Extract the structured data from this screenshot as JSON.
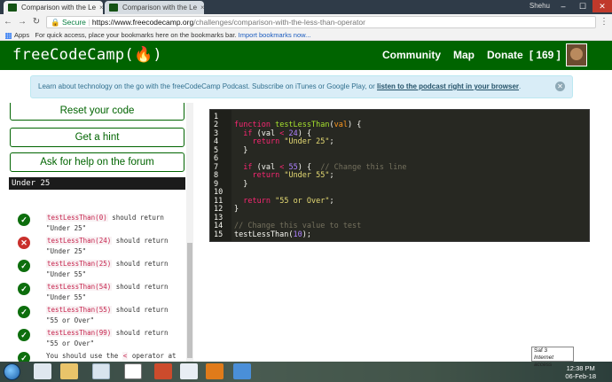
{
  "browser": {
    "tabs": [
      {
        "title": "Comparison with the Le",
        "active": true
      },
      {
        "title": "Comparison with the Le",
        "active": false
      }
    ],
    "user": "Shehu",
    "secure_label": "Secure",
    "url_host": "https://www.freecodecamp.org",
    "url_path": "/challenges/comparison-with-the-less-than-operator",
    "bookmarks_apps": "Apps",
    "bookmarks_hint": "For quick access, place your bookmarks here on the bookmarks bar.",
    "bookmarks_import": "Import bookmarks now..."
  },
  "nav": {
    "logo": "freeCodeCamp(🔥)",
    "community": "Community",
    "map": "Map",
    "donate": "Donate",
    "points": "[ 169 ]"
  },
  "alert": {
    "text": "Learn about technology on the go with the freeCodeCamp Podcast. Subscribe on iTunes or Google Play, or ",
    "link": "listen to the podcast right in your browser",
    "end": "."
  },
  "left": {
    "reset": "Reset your code",
    "hint": "Get a hint",
    "help": "Ask for help on the forum",
    "output": "Under 25",
    "tests": [
      {
        "status": "pass",
        "code": "testLessThan(0)",
        "text": " should return \"Under 25\""
      },
      {
        "status": "fail",
        "code": "testLessThan(24)",
        "text": " should return \"Under 25\""
      },
      {
        "status": "pass",
        "code": "testLessThan(25)",
        "text": " should return \"Under 55\""
      },
      {
        "status": "pass",
        "code": "testLessThan(54)",
        "text": " should return \"Under 55\""
      },
      {
        "status": "pass",
        "code": "testLessThan(55)",
        "text": " should return \"55 or Over\""
      },
      {
        "status": "pass",
        "code": "testLessThan(99)",
        "text": " should return \"55 or Over\""
      },
      {
        "status": "pass",
        "code": "<",
        "text": "You should use the ",
        "text_after": " operator at"
      }
    ]
  },
  "editor": {
    "line_numbers": [
      "1",
      "2",
      "3",
      "4",
      "5",
      "6",
      "7",
      "8",
      "9",
      "10",
      "11",
      "12",
      "13",
      "14",
      "15"
    ]
  },
  "taskbar": {
    "time": "12:38 PM",
    "date": "06-Feb-18",
    "tooltip_line1": "Saf 3",
    "tooltip_line2": "Internet access"
  }
}
